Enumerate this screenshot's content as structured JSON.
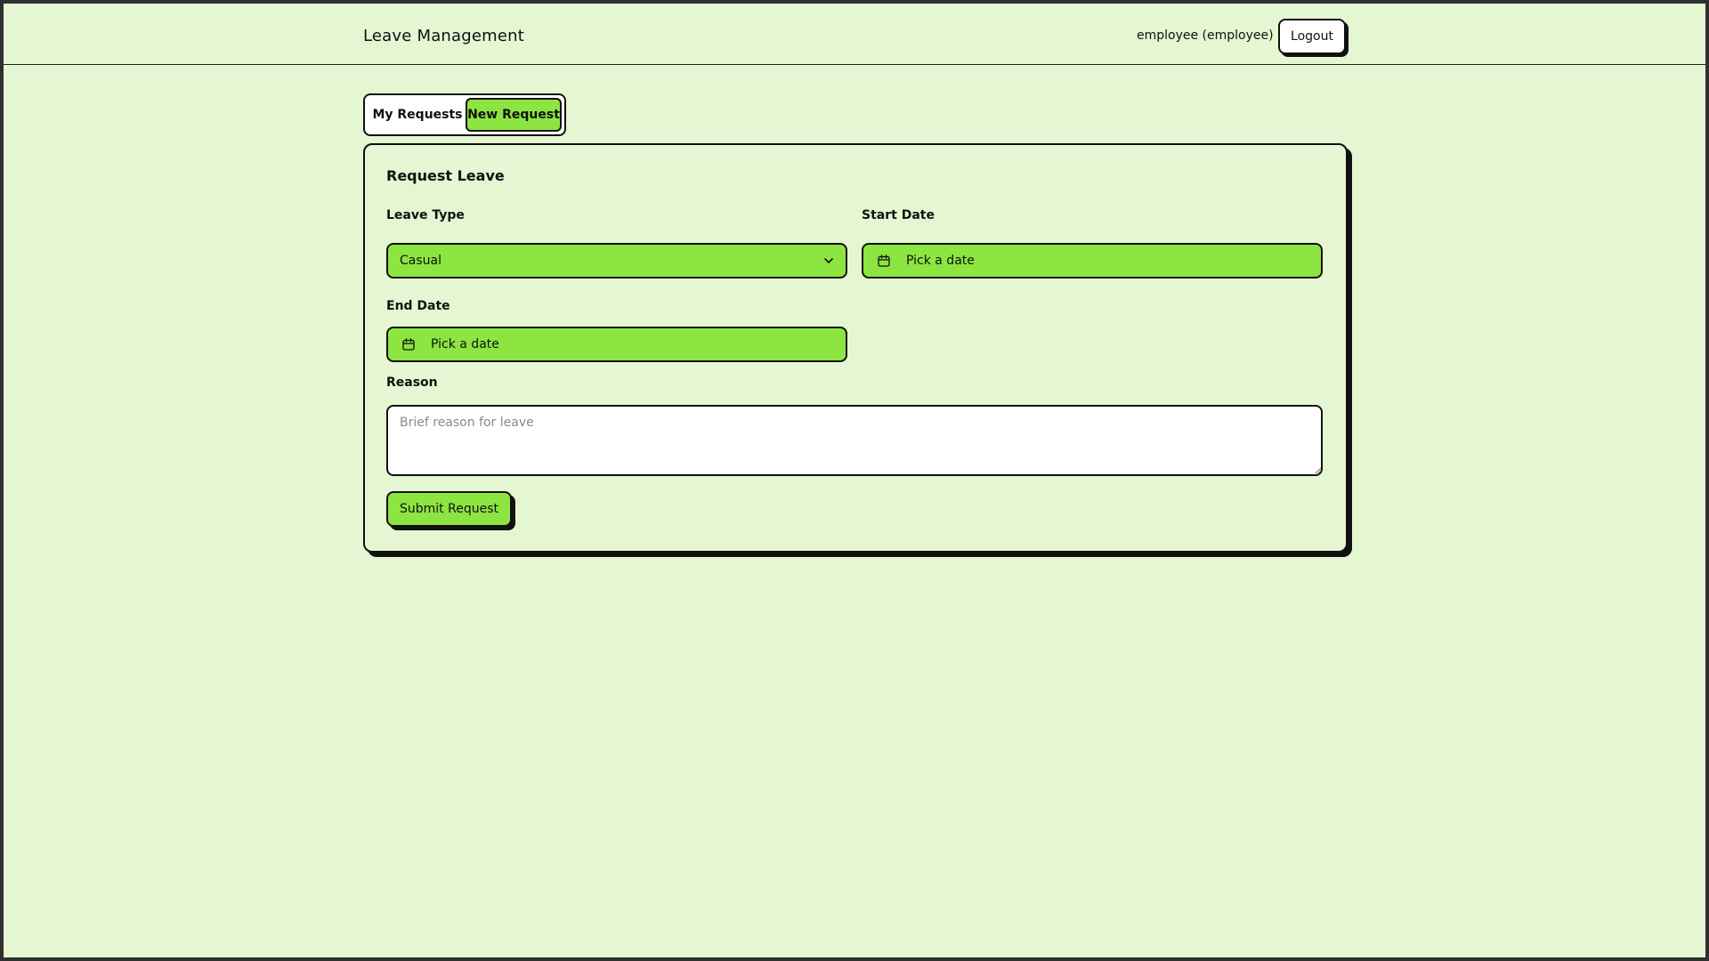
{
  "header": {
    "title": "Leave Management",
    "user_label": "employee (employee)",
    "logout_label": "Logout"
  },
  "tabs": [
    {
      "label": "My Requests",
      "active": false
    },
    {
      "label": "New Request",
      "active": true
    }
  ],
  "form": {
    "title": "Request Leave",
    "leave_type": {
      "label": "Leave Type",
      "value": "Casual",
      "icon": "chevron-down-icon"
    },
    "start_date": {
      "label": "Start Date",
      "value": "Pick a date",
      "icon": "calendar-icon"
    },
    "end_date": {
      "label": "End Date",
      "value": "Pick a date",
      "icon": "calendar-icon"
    },
    "reason": {
      "label": "Reason",
      "placeholder": "Brief reason for leave"
    },
    "submit_label": "Submit Request"
  },
  "colors": {
    "background": "#e4f7d2",
    "accent": "#8ce541",
    "border": "#111111"
  }
}
